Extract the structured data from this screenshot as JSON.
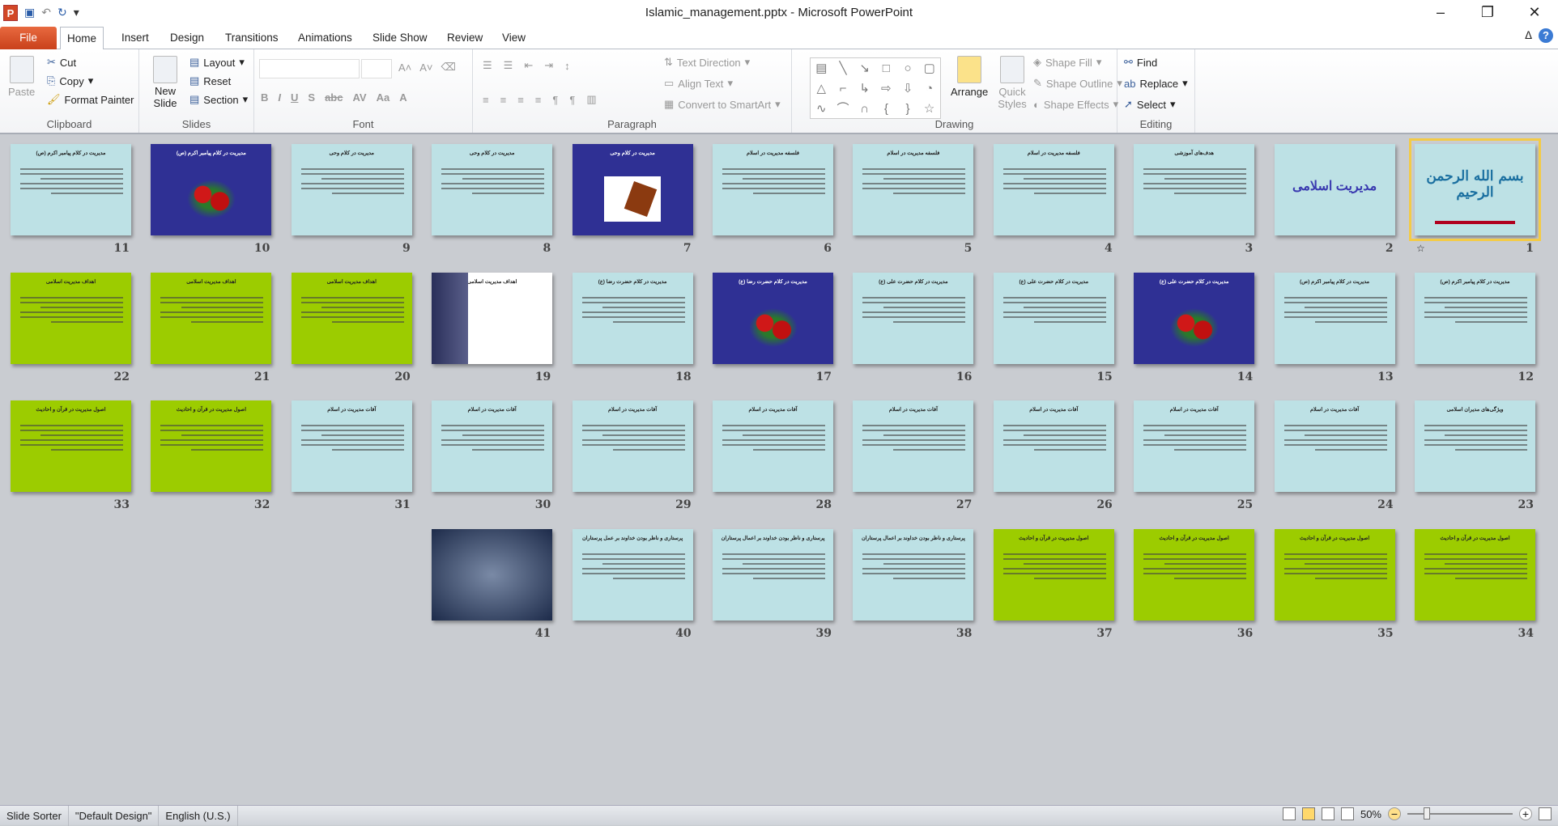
{
  "window": {
    "title": "Islamic_management.pptx - Microsoft PowerPoint"
  },
  "tabs": [
    "File",
    "Home",
    "Insert",
    "Design",
    "Transitions",
    "Animations",
    "Slide Show",
    "Review",
    "View"
  ],
  "ribbon": {
    "clipboard": {
      "label": "Clipboard",
      "paste": "Paste",
      "cut": "Cut",
      "copy": "Copy",
      "format_painter": "Format Painter"
    },
    "slides": {
      "label": "Slides",
      "new_slide": "New Slide",
      "layout": "Layout",
      "reset": "Reset",
      "section": "Section"
    },
    "font": {
      "label": "Font",
      "font_name": "",
      "font_size": ""
    },
    "paragraph": {
      "label": "Paragraph",
      "text_direction": "Text Direction",
      "align_text": "Align Text",
      "convert_smartart": "Convert to SmartArt"
    },
    "drawing": {
      "label": "Drawing",
      "arrange": "Arrange",
      "quick_styles": "Quick Styles",
      "shape_fill": "Shape Fill",
      "shape_outline": "Shape Outline",
      "shape_effects": "Shape Effects"
    },
    "editing": {
      "label": "Editing",
      "find": "Find",
      "replace": "Replace",
      "select": "Select"
    }
  },
  "slides": [
    {
      "n": "1",
      "bg": "light",
      "title": "بسم الله الرحمن الرحیم",
      "selected": true
    },
    {
      "n": "2",
      "bg": "light",
      "title": "مدیریت اسلامی"
    },
    {
      "n": "3",
      "bg": "light",
      "title": "هدف‌های آموزشی"
    },
    {
      "n": "4",
      "bg": "light",
      "title": "فلسفه مدیریت در اسلام"
    },
    {
      "n": "5",
      "bg": "light",
      "title": "فلسفه مدیریت در اسلام"
    },
    {
      "n": "6",
      "bg": "light",
      "title": "فلسفه مدیریت در اسلام"
    },
    {
      "n": "7",
      "bg": "blue",
      "title": "مدیریت در کلام وحی"
    },
    {
      "n": "8",
      "bg": "light",
      "title": "مدیریت در کلام وحی"
    },
    {
      "n": "9",
      "bg": "light",
      "title": "مدیریت در کلام وحی"
    },
    {
      "n": "10",
      "bg": "blue",
      "title": "مدیریت در کلام پیامبر اکرم (ص)"
    },
    {
      "n": "11",
      "bg": "light",
      "title": "مدیریت در کلام پیامبر اکرم (ص)"
    },
    {
      "n": "12",
      "bg": "light",
      "title": "مدیریت در کلام پیامبر اکرم (ص)"
    },
    {
      "n": "13",
      "bg": "light",
      "title": "مدیریت در کلام پیامبر اکرم (ص)"
    },
    {
      "n": "14",
      "bg": "blue",
      "title": "مدیریت در کلام حضرت علی (ع)"
    },
    {
      "n": "15",
      "bg": "light",
      "title": "مدیریت در کلام حضرت علی (ع)"
    },
    {
      "n": "16",
      "bg": "light",
      "title": "مدیریت در کلام حضرت علی (ع)"
    },
    {
      "n": "17",
      "bg": "blue",
      "title": "مدیریت در کلام حضرت رضا (ع)"
    },
    {
      "n": "18",
      "bg": "light",
      "title": "مدیریت در کلام حضرت رضا (ع)"
    },
    {
      "n": "19",
      "bg": "white",
      "title": "اهداف مدیریت اسلامی"
    },
    {
      "n": "20",
      "bg": "green",
      "title": "اهداف مدیریت اسلامی"
    },
    {
      "n": "21",
      "bg": "green",
      "title": "اهداف مدیریت اسلامی"
    },
    {
      "n": "22",
      "bg": "green",
      "title": "اهداف مدیریت اسلامی"
    },
    {
      "n": "23",
      "bg": "light",
      "title": "ویژگی‌های مدیران اسلامی"
    },
    {
      "n": "24",
      "bg": "light",
      "title": "آفات مدیریت در اسلام"
    },
    {
      "n": "25",
      "bg": "light",
      "title": "آفات مدیریت در اسلام"
    },
    {
      "n": "26",
      "bg": "light",
      "title": "آفات مدیریت در اسلام"
    },
    {
      "n": "27",
      "bg": "light",
      "title": "آفات مدیریت در اسلام"
    },
    {
      "n": "28",
      "bg": "light",
      "title": "آفات مدیریت در اسلام"
    },
    {
      "n": "29",
      "bg": "light",
      "title": "آفات مدیریت در اسلام"
    },
    {
      "n": "30",
      "bg": "light",
      "title": "آفات مدیریت در اسلام"
    },
    {
      "n": "31",
      "bg": "light",
      "title": "آفات مدیریت در اسلام"
    },
    {
      "n": "32",
      "bg": "green",
      "title": "اصول مدیریت در قرآن و احادیث"
    },
    {
      "n": "33",
      "bg": "green",
      "title": "اصول مدیریت در قرآن و احادیث"
    },
    {
      "n": "34",
      "bg": "green",
      "title": "اصول مدیریت در قرآن و احادیث"
    },
    {
      "n": "35",
      "bg": "green",
      "title": "اصول مدیریت در قرآن و احادیث"
    },
    {
      "n": "36",
      "bg": "green",
      "title": "اصول مدیریت در قرآن و احادیث"
    },
    {
      "n": "37",
      "bg": "green",
      "title": "اصول مدیریت در قرآن و احادیث"
    },
    {
      "n": "38",
      "bg": "light",
      "title": "پرستاری و ناظر بودن خداوند بر اعمال پرستاران"
    },
    {
      "n": "39",
      "bg": "light",
      "title": "پرستاری و ناظر بودن خداوند بر اعمال پرستاران"
    },
    {
      "n": "40",
      "bg": "light",
      "title": "پرستاری و ناظر بودن خداوند بر عمل پرستاران"
    },
    {
      "n": "41",
      "bg": "photo",
      "title": ""
    }
  ],
  "status": {
    "view": "Slide Sorter",
    "theme": "\"Default Design\"",
    "language": "English (U.S.)",
    "zoom": "50%",
    "zoom_percent": 50
  },
  "colors": {
    "light": "#bde1e5",
    "blue": "#2f3094",
    "green": "#9ccc00",
    "selection": "#f3cb47"
  }
}
